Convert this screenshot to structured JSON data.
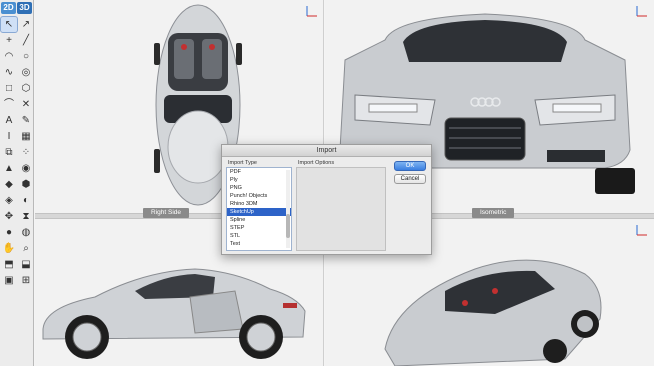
{
  "toolbar": {
    "mode_2d": "2D",
    "mode_3d": "3D",
    "tools": [
      {
        "name": "select-arrow-icon",
        "glyph": "↖"
      },
      {
        "name": "select-vertex-icon",
        "glyph": "↗"
      },
      {
        "name": "point-icon",
        "glyph": "+"
      },
      {
        "name": "line-icon",
        "glyph": "╱"
      },
      {
        "name": "arc-icon",
        "glyph": "◠"
      },
      {
        "name": "circle-icon",
        "glyph": "○"
      },
      {
        "name": "curve-icon",
        "glyph": "∿"
      },
      {
        "name": "spiral-icon",
        "glyph": "◎"
      },
      {
        "name": "rectangle-icon",
        "glyph": "□"
      },
      {
        "name": "polygon-icon",
        "glyph": "⬡"
      },
      {
        "name": "freeform-icon",
        "glyph": "⌒"
      },
      {
        "name": "trim-icon",
        "glyph": "✕"
      },
      {
        "name": "text-icon",
        "glyph": "A"
      },
      {
        "name": "pen-icon",
        "glyph": "✎"
      },
      {
        "name": "dimension-icon",
        "glyph": "I"
      },
      {
        "name": "hatch-icon",
        "glyph": "▦"
      },
      {
        "name": "group-icon",
        "glyph": "⧉"
      },
      {
        "name": "array-icon",
        "glyph": "⁘"
      },
      {
        "name": "extrude-icon",
        "glyph": "▲"
      },
      {
        "name": "revolve-icon",
        "glyph": "◉"
      },
      {
        "name": "loft-icon",
        "glyph": "◆"
      },
      {
        "name": "sweep-icon",
        "glyph": "⬢"
      },
      {
        "name": "boolean-icon",
        "glyph": "◈"
      },
      {
        "name": "fillet-icon",
        "glyph": "◐"
      },
      {
        "name": "transform-icon",
        "glyph": "✥"
      },
      {
        "name": "mirror-icon",
        "glyph": "⧗"
      },
      {
        "name": "material-icon",
        "glyph": "●"
      },
      {
        "name": "render-icon",
        "glyph": "◍"
      },
      {
        "name": "pan-hand-icon",
        "glyph": "✋"
      },
      {
        "name": "zoom-icon",
        "glyph": "⌕"
      },
      {
        "name": "view-top-icon",
        "glyph": "⬒"
      },
      {
        "name": "view-iso-icon",
        "glyph": "⬓"
      },
      {
        "name": "cube-icon",
        "glyph": "▣"
      },
      {
        "name": "wireframe-icon",
        "glyph": "⊞"
      }
    ]
  },
  "viewports": {
    "top_left_label": "Right Side",
    "top_right_label": "Isometric"
  },
  "dialog": {
    "title": "Import",
    "type_header": "Import Type",
    "options_header": "Import Options",
    "ok_label": "OK",
    "cancel_label": "Cancel",
    "types": [
      "PDF",
      "Ply",
      "PNG",
      "Punch! Objects",
      "Rhino 3DM",
      "SketchUp",
      "Spline",
      "STEP",
      "STL",
      "Text"
    ],
    "selected_type": "SketchUp"
  },
  "colors": {
    "accent_selection": "#2d63c8",
    "car_body": "#c9ccd0"
  }
}
